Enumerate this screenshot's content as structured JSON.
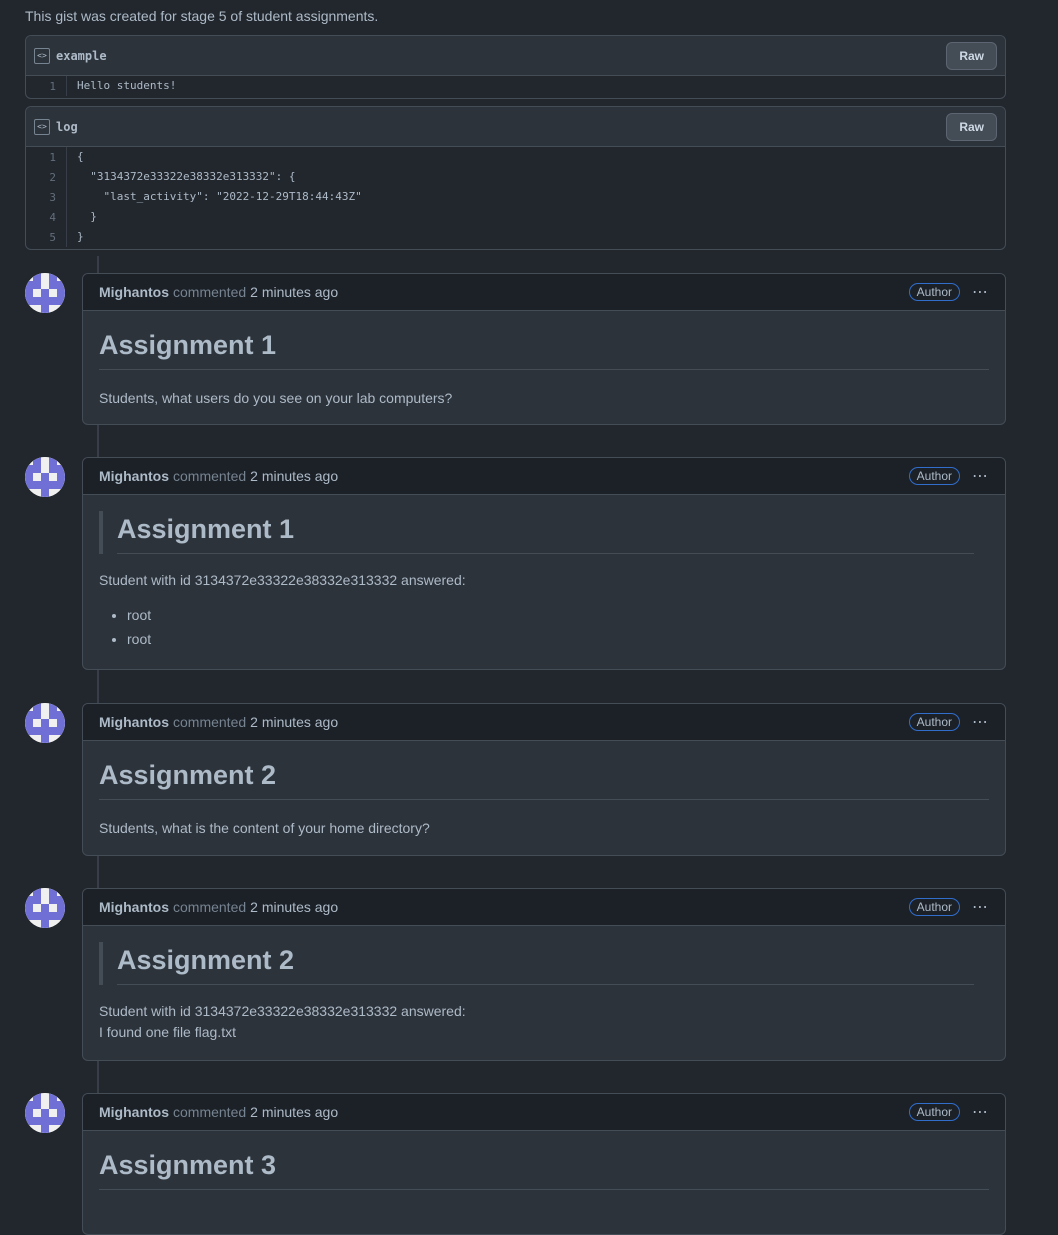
{
  "description": "This gist was created for stage 5 of student assignments.",
  "files": [
    {
      "name": "example",
      "raw_label": "Raw",
      "lines": [
        {
          "num": "1",
          "code": "Hello students!"
        }
      ]
    },
    {
      "name": "log",
      "raw_label": "Raw",
      "lines": [
        {
          "num": "1",
          "code": "{"
        },
        {
          "num": "2",
          "code": "  \"3134372e33322e38332e313332\": {"
        },
        {
          "num": "3",
          "code": "    \"last_activity\": \"2022-12-29T18:44:43Z\""
        },
        {
          "num": "4",
          "code": "  }"
        },
        {
          "num": "5",
          "code": "}"
        }
      ]
    }
  ],
  "comments": [
    {
      "author": "Mighantos",
      "action": "commented",
      "time": "2 minutes ago",
      "badge": "Author",
      "heading": "Assignment 1",
      "text": "Students, what users do you see on your lab computers?"
    },
    {
      "author": "Mighantos",
      "action": "commented",
      "time": "2 minutes ago",
      "badge": "Author",
      "heading": "Assignment 1",
      "text": "Student with id 3134372e33322e38332e313332 answered:",
      "items": [
        "root",
        "root"
      ]
    },
    {
      "author": "Mighantos",
      "action": "commented",
      "time": "2 minutes ago",
      "badge": "Author",
      "heading": "Assignment 2",
      "text": "Students, what is the content of your home directory?"
    },
    {
      "author": "Mighantos",
      "action": "commented",
      "time": "2 minutes ago",
      "badge": "Author",
      "heading": "Assignment 2",
      "text": "Student with id 3134372e33322e38332e313332 answered:",
      "text2": "I found one file flag.txt"
    },
    {
      "author": "Mighantos",
      "action": "commented",
      "time": "2 minutes ago",
      "badge": "Author",
      "heading": "Assignment 3"
    }
  ],
  "colors": {
    "background": "#22272e",
    "header": "#2d333b",
    "comment_header": "#1c2128",
    "accent": "#316dca",
    "avatar": "#6f6fd6"
  },
  "icons": {
    "file": "code-file-icon",
    "kebab": "kebab-horizontal-icon"
  }
}
